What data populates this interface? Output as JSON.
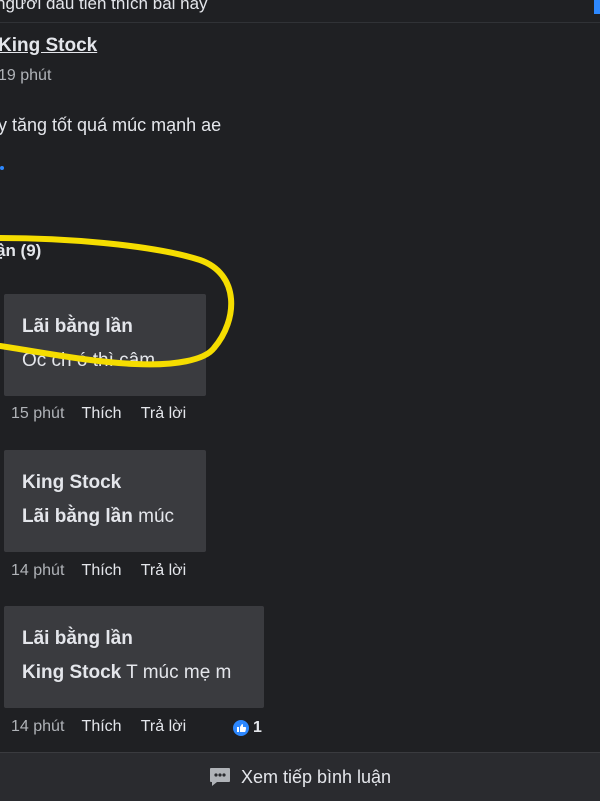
{
  "top_text": "người đầu tiên thích bài này",
  "post": {
    "author": "King Stock",
    "time": "19 phút",
    "text": "y tăng tốt quá múc mạnh ae"
  },
  "comments_heading": "ận (9)",
  "comments": [
    {
      "author": "Lãi bằng lần",
      "mention": "",
      "text": "Óc ch ó thì câm",
      "time": "15 phút",
      "like_label": "Thích",
      "reply_label": "Trả lời"
    },
    {
      "author": "King Stock",
      "mention": "Lãi bằng lần",
      "text": " múc",
      "time": "14 phút",
      "like_label": "Thích",
      "reply_label": "Trả lời"
    },
    {
      "author": "Lãi bằng lần",
      "mention": "King Stock",
      "text": " T múc mẹ m",
      "time": "14 phút",
      "like_label": "Thích",
      "reply_label": "Trả lời",
      "reaction_count": "1"
    }
  ],
  "footer": {
    "label": "Xem tiếp bình luận",
    "icon": "comment-icon"
  },
  "colors": {
    "background": "#1f2023",
    "bubble": "#3a3b3f",
    "accent": "#2d88ff",
    "highlight": "#f5dd00"
  }
}
